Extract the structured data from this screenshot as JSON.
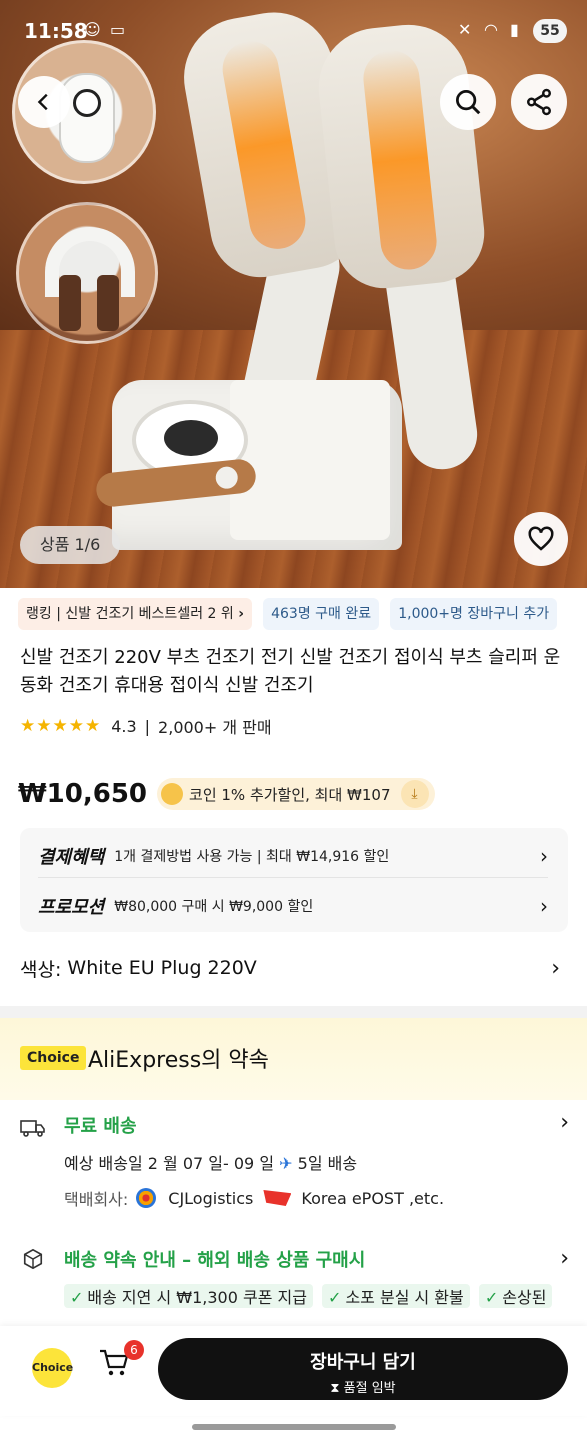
{
  "status_bar": {
    "time": "11:58",
    "battery": "55"
  },
  "gallery": {
    "counter": "상품 1/6"
  },
  "tags": [
    {
      "label": "랭킹 | 신발 건조기 베스트셀러 2 위",
      "chevron": "›"
    },
    {
      "label": "463명 구매 완료"
    },
    {
      "label": "1,000+명 장바구니 추가"
    }
  ],
  "product": {
    "title": "신발 건조기 220V 부츠 건조기 전기 신발 건조기 접이식 부츠 슬리퍼 운동화 건조기 휴대용 접이식 신발 건조기",
    "rating": "4.3",
    "stars": "★★★★★",
    "sold": "2,000+ 개 판매",
    "price": "₩10,650",
    "coin_promo": "코인 1% 추가할인, 최대 ₩107"
  },
  "benefits": {
    "payment_label": "결제혜택",
    "payment_text": "1개 결제방법 사용 가능 | 최대 ₩14,916 할인",
    "promo_label": "프로모션",
    "promo_text": "₩80,000 구매 시 ₩9,000 할인"
  },
  "color": {
    "label": "색상:",
    "value": "White EU Plug 220V"
  },
  "promise": {
    "badge": "Choice",
    "title": "AliExpress의 약속"
  },
  "shipping": {
    "title": "무료 배송",
    "date_prefix": "예상 배송일 2 월 07 일- 09 일",
    "days": "5일 배송",
    "courier_label": "택배회사:",
    "courier_1": "CJLogistics",
    "courier_2": "Korea ePOST ,etc."
  },
  "guide": {
    "title": "배송 약속 안내 – 해외 배송 상품 구매시",
    "items": [
      "배송 지연 시 ₩1,300 쿠폰 지급",
      "소포 분실 시 환불",
      "손상된"
    ]
  },
  "bottom": {
    "choice": "Choice",
    "cart_count": "6",
    "cta_main": "장바구니 담기",
    "cta_sub": "품절 임박"
  },
  "colors": {
    "accent": "#111111",
    "choice_yellow": "#fce43a",
    "green": "#24a148",
    "badge_red": "#e8322b"
  }
}
